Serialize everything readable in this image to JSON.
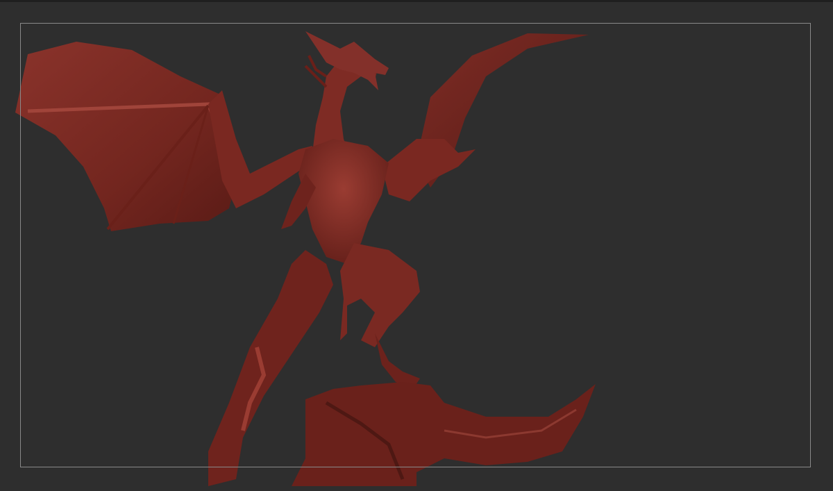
{
  "viewport": {
    "background": "#2e2e2e",
    "frame_color": "#8a8a8a"
  },
  "model": {
    "subject": "dragon-sculpt",
    "base_color": "#7b2a24",
    "shadow_color": "#4a1512",
    "highlight_color": "#a3443a"
  }
}
